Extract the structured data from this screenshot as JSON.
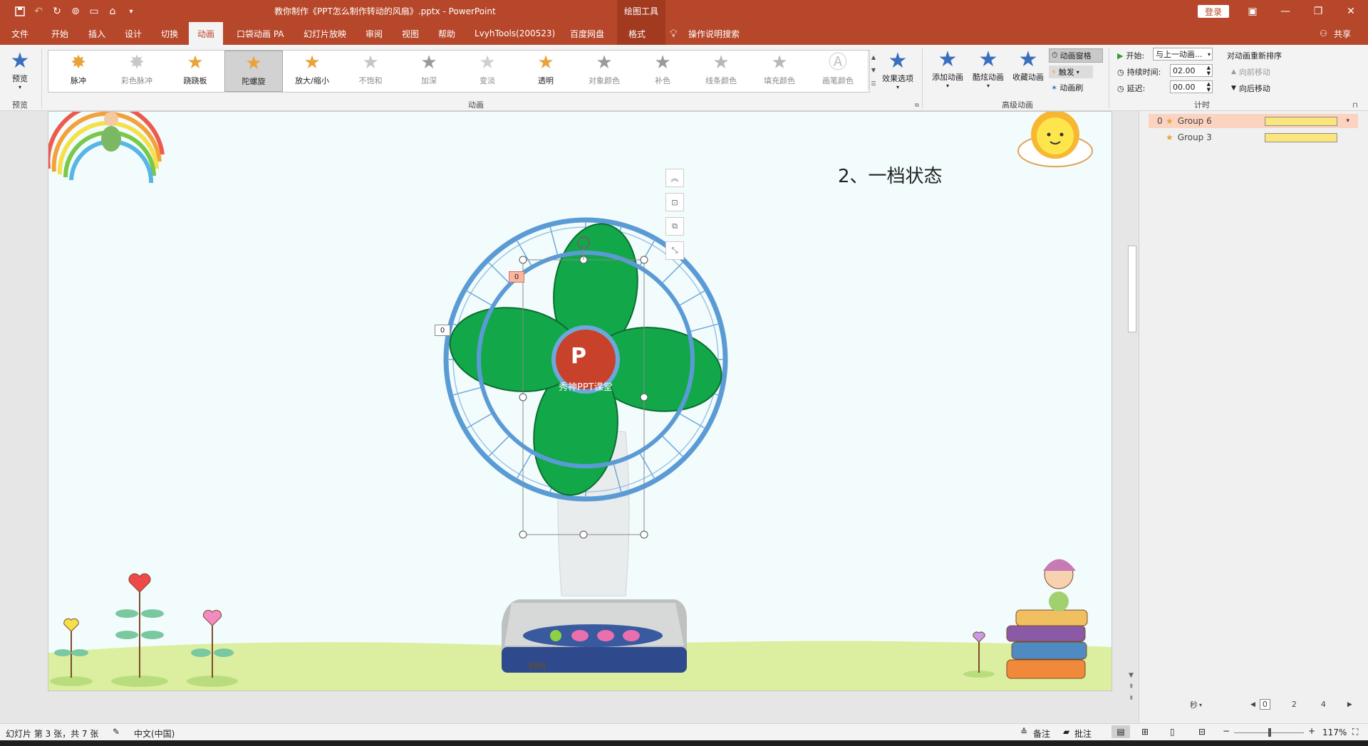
{
  "window": {
    "title": "教你制作《PPT怎么制作转动的风扇》.pptx  -  PowerPoint",
    "context_tools": "绘图工具",
    "login": "登录"
  },
  "tabs": [
    {
      "label": "文件"
    },
    {
      "label": "开始"
    },
    {
      "label": "插入"
    },
    {
      "label": "设计"
    },
    {
      "label": "切换"
    },
    {
      "label": "动画"
    },
    {
      "label": "口袋动画 PA"
    },
    {
      "label": "幻灯片放映"
    },
    {
      "label": "审阅"
    },
    {
      "label": "视图"
    },
    {
      "label": "帮助"
    },
    {
      "label": "LvyhTools(200523)"
    },
    {
      "label": "百度网盘"
    },
    {
      "label": "格式"
    }
  ],
  "tell_me": "操作说明搜索",
  "share": "共享",
  "ribbon": {
    "preview": {
      "label": "预览",
      "group": "预览"
    },
    "gallery_group": "动画",
    "gallery": [
      {
        "label": "脉冲",
        "color": "#e8a33a"
      },
      {
        "label": "彩色脉冲",
        "color": "#c8c8c8"
      },
      {
        "label": "跷跷板",
        "color": "#e8a33a"
      },
      {
        "label": "陀螺旋",
        "color": "#e8a33a"
      },
      {
        "label": "放大/缩小",
        "color": "#e8a33a"
      },
      {
        "label": "不饱和",
        "color": "#c6c6c6"
      },
      {
        "label": "加深",
        "color": "#9a9a9a"
      },
      {
        "label": "变淡",
        "color": "#cfcfcf"
      },
      {
        "label": "透明",
        "color": "#e8a33a"
      },
      {
        "label": "对象颜色",
        "color": "#9a9a9a"
      },
      {
        "label": "补色",
        "color": "#9a9a9a"
      },
      {
        "label": "线条颜色",
        "color": "#b8b8b8"
      },
      {
        "label": "填充颜色",
        "color": "#b8b8b8"
      },
      {
        "label": "画笔颜色",
        "color": "#c6c6c6"
      }
    ],
    "effect_options": "效果选项",
    "advanced": {
      "group": "高级动画",
      "add": "添加动画",
      "cool": "酷炫动画",
      "fav": "收藏动画",
      "pane": "动画窗格",
      "trigger": "触发",
      "painter": "动画刷"
    },
    "timing": {
      "group": "计时",
      "start_label": "开始:",
      "start_value": "与上一动画...",
      "duration_label": "持续时间:",
      "duration_value": "02.00",
      "delay_label": "延迟:",
      "delay_value": "00.00",
      "reorder": "对动画重新排序",
      "forward": "向前移动",
      "backward": "向后移动"
    }
  },
  "slide": {
    "text": "2、一档状态",
    "tag_top": "0",
    "tag_left": "0",
    "logo_letter": "P",
    "logo_caption": "秀神PPT课堂",
    "brand_mark": "MM"
  },
  "anim_pane": {
    "items": [
      {
        "index": "0",
        "name": "Group 6"
      },
      {
        "index": "",
        "name": "Group 3"
      }
    ],
    "seconds": "秒",
    "scale": [
      "0",
      "2",
      "4"
    ]
  },
  "status": {
    "slide_info": "幻灯片 第 3 张，共 7 张",
    "language": "中文(中国)",
    "notes": "备注",
    "comments": "批注",
    "zoom": "117%"
  },
  "colors": {
    "brand": "#b7472a",
    "fan_blade": "#12a84a",
    "fan_ring": "#5b9bd5"
  }
}
